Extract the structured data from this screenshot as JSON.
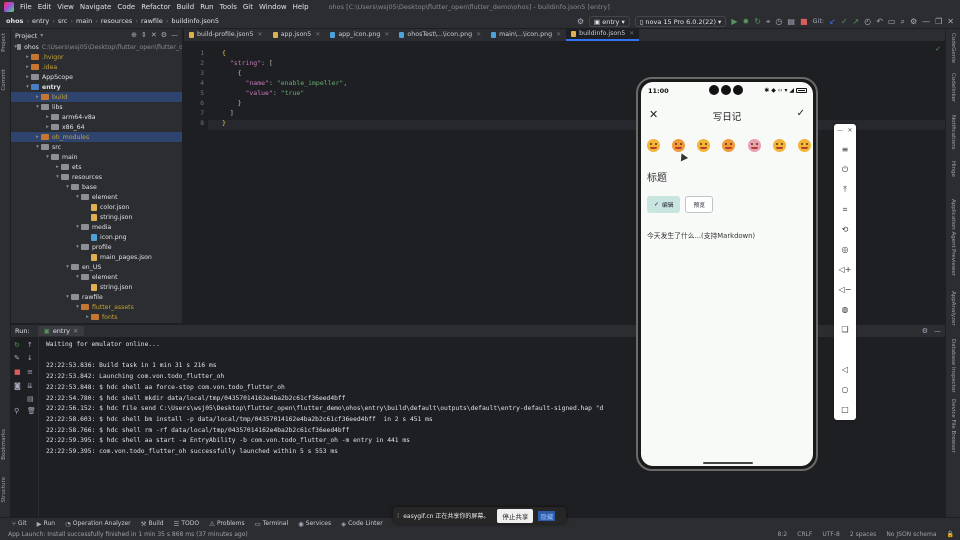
{
  "menu": {
    "items": [
      "File",
      "Edit",
      "View",
      "Navigate",
      "Code",
      "Refactor",
      "Build",
      "Run",
      "Tools",
      "Git",
      "Window",
      "Help"
    ],
    "project_title": "ohos [C:\\Users\\wsj05\\Desktop\\flutter_open\\flutter_demo\\ohos] - buildinfo.json5 [entry]"
  },
  "toolbar": {
    "breadcrumbs": [
      "ohos",
      "entry",
      "src",
      "main",
      "resources",
      "rawfile",
      "buildinfo.json5"
    ],
    "run_config": "entry",
    "device": "nova 15 Pro 6.0.2(22)",
    "git_label": "Git:"
  },
  "left_strip": {
    "labels": [
      "Project",
      "Commit",
      "Bookmarks",
      "Structure"
    ]
  },
  "right_strip": {
    "labels": [
      "CodeGenie",
      "Codelinker",
      "Notifications",
      "Hinge",
      "Application Agent",
      "Previewer",
      "AppAnalyzer",
      "Database Inspector",
      "Device File Browser"
    ]
  },
  "project_panel": {
    "header": "Project",
    "tree": [
      {
        "label": "ohos",
        "extra": "C:\\Users\\wsj05\\Desktop\\flutter_open\\flutter_d",
        "depth": 0,
        "open": true,
        "kind": "folder",
        "color": "gray"
      },
      {
        "label": ".hvigor",
        "depth": 1,
        "open": false,
        "kind": "folder",
        "color": "orange",
        "text_color": "orange"
      },
      {
        "label": ".idea",
        "depth": 1,
        "open": false,
        "kind": "folder",
        "color": "orange",
        "text_color": "orange"
      },
      {
        "label": "AppScope",
        "depth": 1,
        "open": false,
        "kind": "folder",
        "color": "gray"
      },
      {
        "label": "entry",
        "depth": 1,
        "open": true,
        "kind": "folder",
        "color": "blue",
        "bold": true
      },
      {
        "label": "build",
        "depth": 2,
        "open": false,
        "kind": "folder",
        "color": "orange",
        "text_color": "orange",
        "selected": true
      },
      {
        "label": "libs",
        "depth": 2,
        "open": true,
        "kind": "folder",
        "color": "gray"
      },
      {
        "label": "arm64-v8a",
        "depth": 3,
        "open": false,
        "kind": "folder",
        "color": "gray"
      },
      {
        "label": "x86_64",
        "depth": 3,
        "open": false,
        "kind": "folder",
        "color": "gray"
      },
      {
        "label": "oh_modules",
        "depth": 2,
        "open": false,
        "kind": "folder",
        "color": "orange",
        "text_color": "orange",
        "selected": true
      },
      {
        "label": "src",
        "depth": 2,
        "open": true,
        "kind": "folder",
        "color": "gray"
      },
      {
        "label": "main",
        "depth": 3,
        "open": true,
        "kind": "folder",
        "color": "gray"
      },
      {
        "label": "ets",
        "depth": 4,
        "open": false,
        "kind": "folder",
        "color": "gray"
      },
      {
        "label": "resources",
        "depth": 4,
        "open": true,
        "kind": "folder",
        "color": "gray"
      },
      {
        "label": "base",
        "depth": 5,
        "open": true,
        "kind": "folder",
        "color": "gray"
      },
      {
        "label": "element",
        "depth": 6,
        "open": true,
        "kind": "folder",
        "color": "gray"
      },
      {
        "label": "color.json",
        "depth": 7,
        "kind": "file",
        "type": "json"
      },
      {
        "label": "string.json",
        "depth": 7,
        "kind": "file",
        "type": "json"
      },
      {
        "label": "media",
        "depth": 6,
        "open": true,
        "kind": "folder",
        "color": "gray"
      },
      {
        "label": "icon.png",
        "depth": 7,
        "kind": "file",
        "type": "img"
      },
      {
        "label": "profile",
        "depth": 6,
        "open": true,
        "kind": "folder",
        "color": "gray"
      },
      {
        "label": "main_pages.json",
        "depth": 7,
        "kind": "file",
        "type": "json"
      },
      {
        "label": "en_US",
        "depth": 5,
        "open": true,
        "kind": "folder",
        "color": "gray"
      },
      {
        "label": "element",
        "depth": 6,
        "open": true,
        "kind": "folder",
        "color": "gray"
      },
      {
        "label": "string.json",
        "depth": 7,
        "kind": "file",
        "type": "json"
      },
      {
        "label": "rawfile",
        "depth": 5,
        "open": true,
        "kind": "folder",
        "color": "gray"
      },
      {
        "label": "flutter_assets",
        "depth": 6,
        "open": true,
        "kind": "folder",
        "color": "orange",
        "text_color": "orange"
      },
      {
        "label": "fonts",
        "depth": 7,
        "open": false,
        "kind": "folder",
        "color": "orange",
        "text_color": "orange"
      }
    ]
  },
  "editor_tabs": [
    {
      "label": "build-profile.json5",
      "icon": "json"
    },
    {
      "label": "app.json5",
      "icon": "json"
    },
    {
      "label": "app_icon.png",
      "icon": "img"
    },
    {
      "label": "ohosTest\\...\\icon.png",
      "icon": "img"
    },
    {
      "label": "main\\...\\icon.png",
      "icon": "img"
    },
    {
      "label": "buildinfo.json5",
      "icon": "json",
      "active": true
    }
  ],
  "editor": {
    "line_numbers": [
      "1",
      "2",
      "3",
      "4",
      "5",
      "6",
      "7",
      "8"
    ],
    "lines": [
      [
        {
          "t": "{",
          "c": "brace"
        }
      ],
      [
        {
          "t": "  "
        },
        {
          "t": "\"string\"",
          "c": "k"
        },
        {
          "t": ": ["
        }
      ],
      [
        {
          "t": "    {"
        }
      ],
      [
        {
          "t": "      "
        },
        {
          "t": "\"name\"",
          "c": "k"
        },
        {
          "t": ": "
        },
        {
          "t": "\"enable_impeller\"",
          "c": "s"
        },
        {
          "t": ","
        }
      ],
      [
        {
          "t": "      "
        },
        {
          "t": "\"value\"",
          "c": "k"
        },
        {
          "t": ": "
        },
        {
          "t": "\"true\"",
          "c": "s"
        }
      ],
      [
        {
          "t": "    }"
        }
      ],
      [
        {
          "t": "  ]"
        }
      ],
      [
        {
          "t": "}",
          "c": "brace"
        }
      ]
    ]
  },
  "run_panel": {
    "label": "Run:",
    "tab": "entry",
    "lines": [
      "Waiting for emulator online...",
      "",
      "22:22:53.836: Build task in 1 min 31 s 216 ms",
      "22:22:53.842: Launching com.von.todo_flutter_oh",
      "22:22:53.848: $ hdc shell aa force-stop com.von.todo_flutter_oh",
      "22:22:54.780: $ hdc shell mkdir data/local/tmp/04357014162e4ba2b2c61cf36eed4bff",
      "22:22:56.152: $ hdc file send C:\\Users\\wsj05\\Desktop\\flutter_open\\flutter_demo\\ohos\\entry\\build\\default\\outputs\\default\\entry-default-signed.hap \"d                               in 2 s 571 ms",
      "22:22:58.603: $ hdc shell bm install -p data/local/tmp/04357014162e4ba2b2c61cf36eed4bff  in 2 s 451 ms",
      "22:22:58.766: $ hdc shell rm -rf data/local/tmp/04357014162e4ba2b2c61cf36eed4bff",
      "22:22:59.395: $ hdc shell aa start -a EntryAbility -b com.von.todo_flutter_oh -m entry in 441 ms",
      "22:22:59.395: com.von.todo_flutter_oh successfully launched within 5 s 553 ms"
    ]
  },
  "tool_windows": [
    "Git",
    "Run",
    "Operation Analyzer",
    "Build",
    "TODO",
    "Problems",
    "Terminal",
    "Services",
    "Code Linter"
  ],
  "status": {
    "message": "App Launch: Install successfully finished in 1 min 35 s 868 ms (37 minutes ago)",
    "position": "8:2",
    "line_sep": "CRLF",
    "encoding": "UTF-8",
    "indent": "2 spaces",
    "schema": "No JSON schema"
  },
  "share_bar": {
    "text": "easygif.cn 正在共享你的屏幕。",
    "stop": "停止共享",
    "hide": "隐藏"
  },
  "phone": {
    "time": "11:00",
    "status_icons": "✱ ◆ ‹› ▾ ◢",
    "title": "写日记",
    "moods": [
      "happy",
      "love",
      "smile",
      "angry",
      "shock",
      "cool",
      "think"
    ],
    "title_placeholder": "标题",
    "edit_label": "编辑",
    "preview_label": "预览",
    "body_placeholder": "今天发生了什么...(支持Markdown)"
  },
  "emu_tools": [
    "minimize",
    "close",
    "menu",
    "power",
    "rotate-top",
    "crop",
    "reset",
    "location",
    "volume-up",
    "volume-down",
    "screenshot",
    "multi-window",
    "back",
    "home",
    "recents"
  ]
}
